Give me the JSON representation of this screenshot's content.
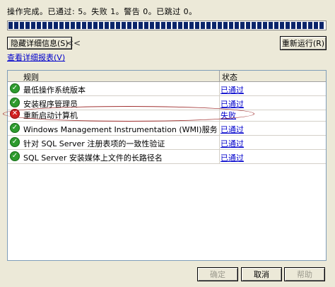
{
  "status_text": "操作完成。已通过: 5。失败 1。警告 0。已跳过 0。",
  "progress": {
    "percent": 100
  },
  "buttons": {
    "hide_details": "隐藏详细信息(S)",
    "hide_chevron": "<<",
    "rerun": "重新运行(R)",
    "ok": "确定",
    "cancel": "取消",
    "help": "帮助"
  },
  "view_report_link": "查看详细报表(V)",
  "table": {
    "columns": [
      "规则",
      "状态"
    ],
    "rows": [
      {
        "rule": "最低操作系统版本",
        "status": "已通过",
        "result": "pass"
      },
      {
        "rule": "安装程序管理员",
        "status": "已通过",
        "result": "pass"
      },
      {
        "rule": "重新启动计算机",
        "status": "失败",
        "result": "fail"
      },
      {
        "rule": "Windows Management Instrumentation (WMI)服务",
        "status": "已通过",
        "result": "pass"
      },
      {
        "rule": "针对 SQL Server 注册表项的一致性验证",
        "status": "已通过",
        "result": "pass"
      },
      {
        "rule": "SQL Server 安装媒体上文件的长路径名",
        "status": "已通过",
        "result": "pass"
      }
    ]
  },
  "colors": {
    "pass": "#2e9b2e",
    "fail": "#d42020",
    "link": "#0000cc",
    "progress": "#0a246a"
  }
}
